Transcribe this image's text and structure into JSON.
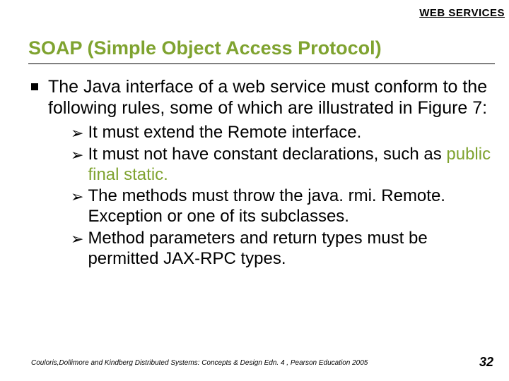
{
  "header_label": "WEB SERVICES",
  "title": "SOAP (Simple Object Access Protocol)",
  "main_bullet": "The Java interface of a web service must conform to the following rules, some of which are illustrated in Figure 7:",
  "sub_bullets": {
    "a": "It must extend the Remote interface.",
    "b_pre": "It must not have constant declarations, such as ",
    "b_accent": "public final static.",
    "c": "The methods must throw the java. rmi. Remote. Exception or one of its subclasses.",
    "d": "Method parameters and return types must be permitted JAX-RPC types."
  },
  "footer": "Couloris,Dollimore and Kindberg  Distributed Systems: Concepts & Design  Edn. 4 , Pearson Education 2005",
  "page_number": "32"
}
